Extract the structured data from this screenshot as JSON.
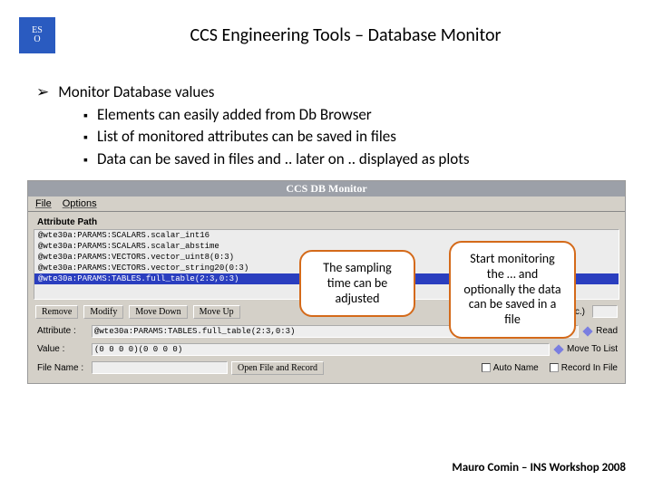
{
  "header": {
    "logo_line1": "ES",
    "logo_line2": "O",
    "title": "CCS Engineering Tools – Database Monitor"
  },
  "bullets": {
    "main": "Monitor Database values",
    "sub1": "Elements can easily added from Db Browser",
    "sub2": "List of monitored attributes can be saved in files",
    "sub3": "Data can be saved in files and .. later on .. displayed as plots"
  },
  "screenshot": {
    "window_title": "CCS DB Monitor",
    "menu_file": "File",
    "menu_options": "Options",
    "col_header": "Attribute Path",
    "rows": [
      "@wte30a:PARAMS:SCALARS.scalar_int16",
      "@wte30a:PARAMS:SCALARS.scalar_abstime",
      "@wte30a:PARAMS:VECTORS.vector_uint8(0:3)",
      "@wte30a:PARAMS:VECTORS.vector_string20(0:3)",
      "@wte30a:PARAMS:TABLES.full_table(2:3,0:3)"
    ],
    "btn_remove": "Remove",
    "btn_modify": "Modify",
    "btn_movedown": "Move Down",
    "btn_moveup": "Move Up",
    "lbl_period": "Updating Period (sec.)",
    "lbl_attribute": "Attribute :",
    "val_attribute": "@wte30a:PARAMS:TABLES.full_table(2:3,0:3)",
    "lbl_value": "Value :",
    "val_value": "(0 0 0 0)(0 0 0 0)",
    "lbl_filename": "File Name :",
    "btn_openfile": "Open File and Record",
    "lbl_read": "Read",
    "lbl_movetolist": "Move To List",
    "lbl_autoname": "Auto Name",
    "lbl_recordinfile": "Record In File"
  },
  "callouts": {
    "c1": "The sampling time can be adjusted",
    "c2": "Start monitoring the … and optionally the data can be saved in a file"
  },
  "footer": "Mauro Comin – INS Workshop 2008"
}
